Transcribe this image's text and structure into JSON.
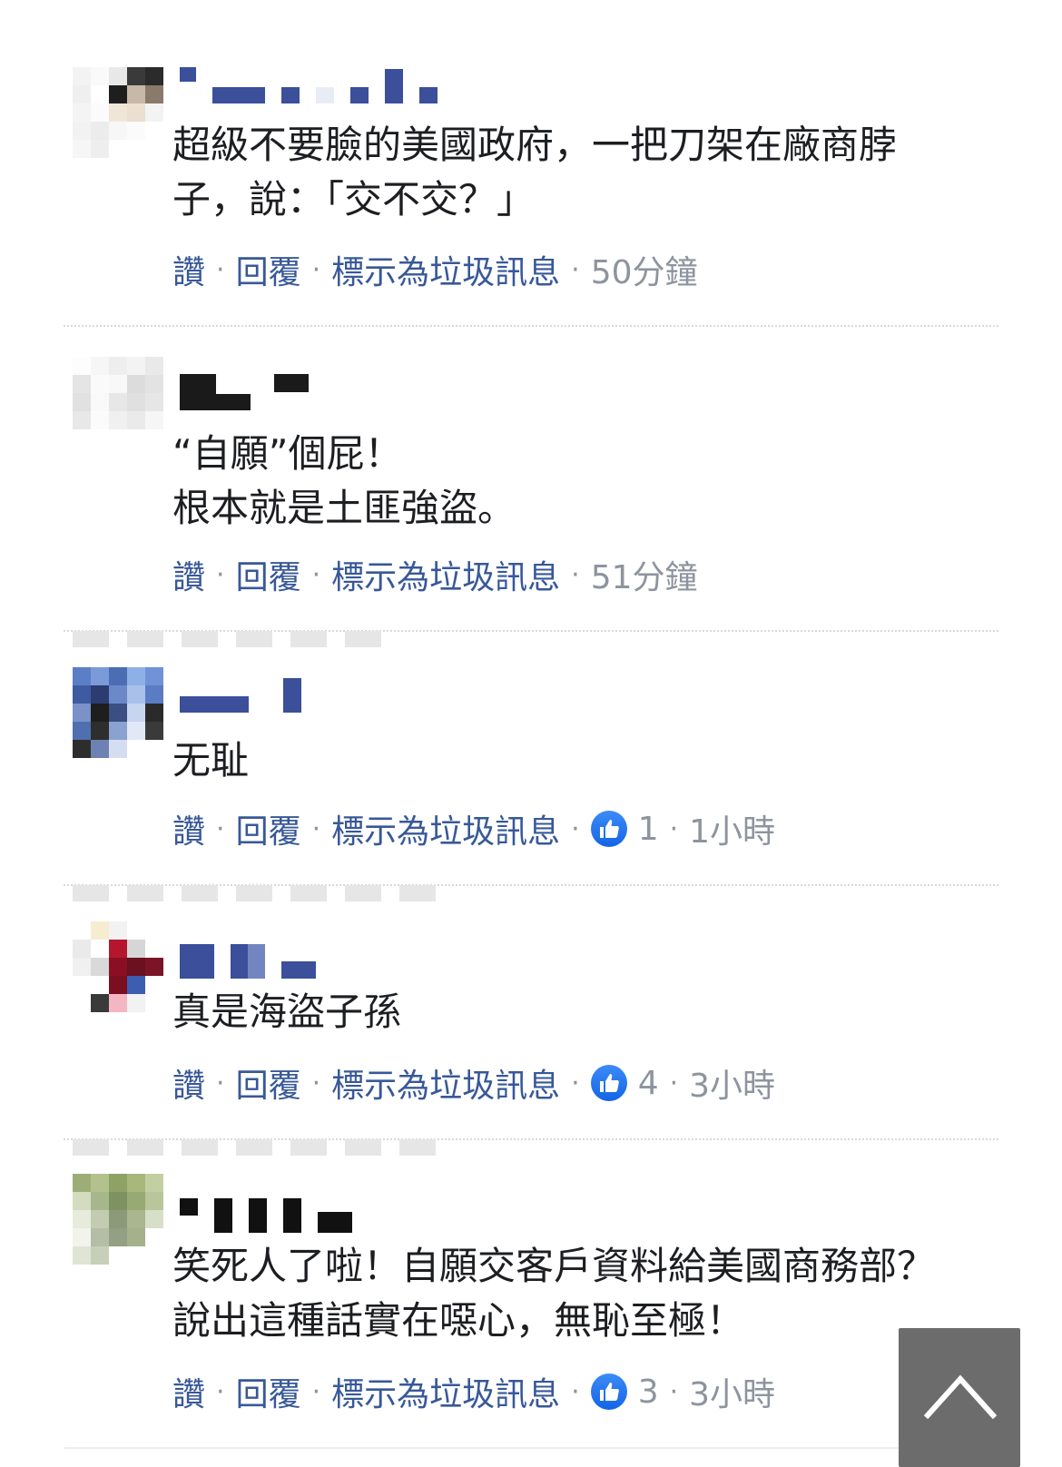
{
  "actions": {
    "like": "讚",
    "reply": "回覆",
    "mark_spam": "標示為垃圾訊息",
    "separator": "·"
  },
  "colors": {
    "link": "#385898",
    "meta": "#8d949e",
    "text": "#1c1e21",
    "like_badge": "#1877f2"
  },
  "comments": [
    {
      "lines": "超級不要臉的美國政府，一把刀架在廠商脖\n子，說：「交不交？」",
      "reactions": null,
      "time": "50分鐘"
    },
    {
      "lines": "“自願”個屁！\n根本就是土匪強盜。",
      "reactions": null,
      "time": "51分鐘"
    },
    {
      "lines": "无耻",
      "reactions": "1",
      "time": "1小時"
    },
    {
      "lines": "真是海盜子孫",
      "reactions": "4",
      "time": "3小時"
    },
    {
      "lines": "笑死人了啦！自願交客戶資料給美國商務部？\n說出這種話實在噁心，無恥至極！",
      "reactions": "3",
      "time": "3小時"
    }
  ],
  "icons": {
    "like_badge": "thumbs-up-icon",
    "scroll_top": "chevron-up-icon"
  }
}
